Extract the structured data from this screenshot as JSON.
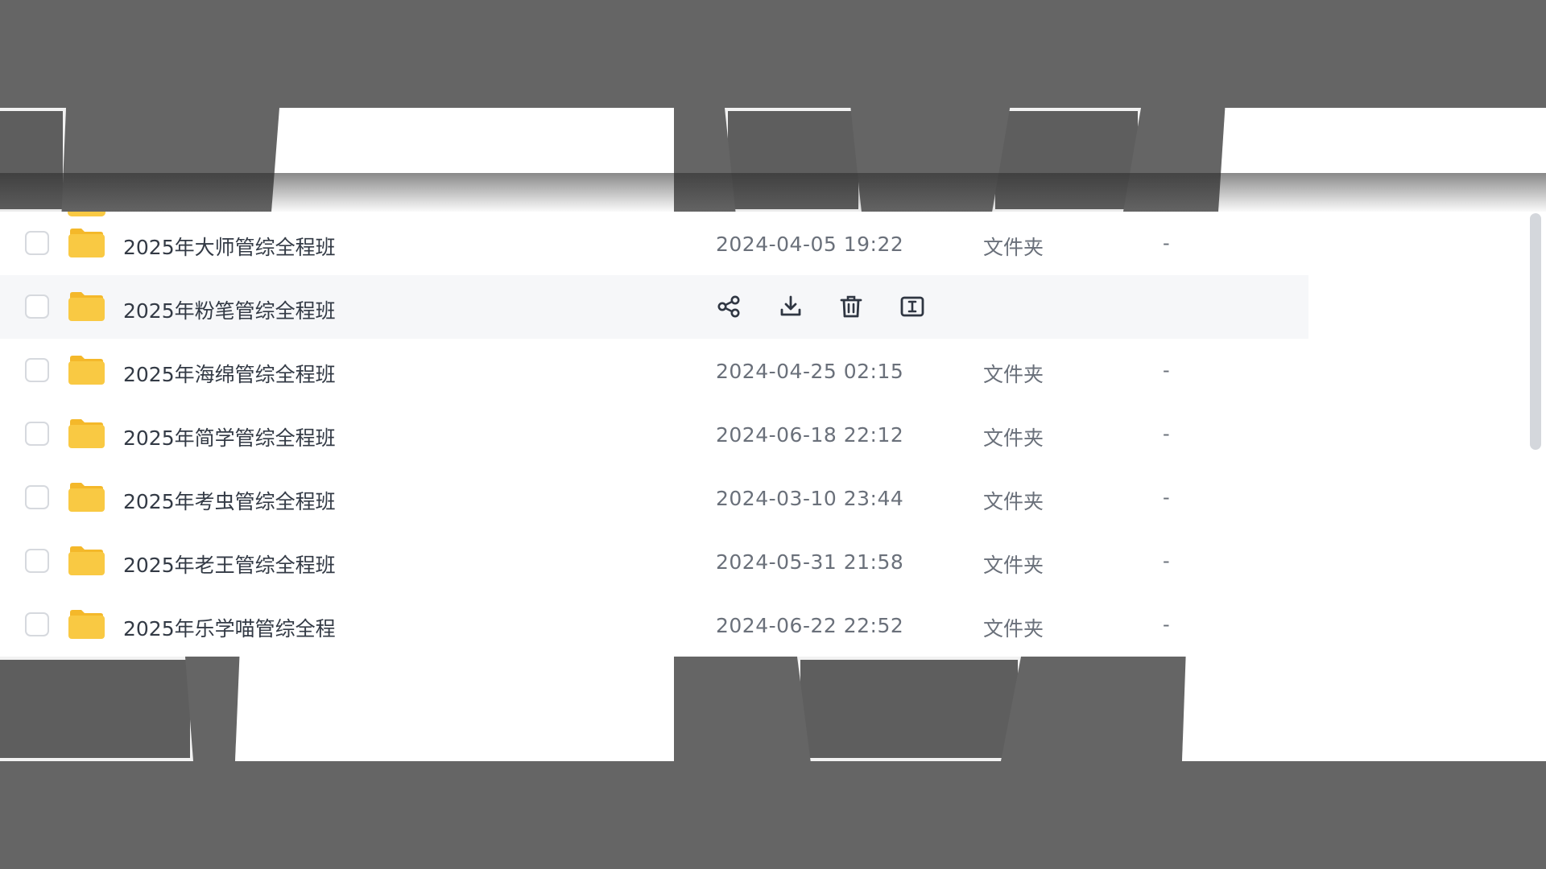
{
  "colors": {
    "folder": "#f9c943",
    "folder_tab": "#f4b82a",
    "text_primary": "#333a45",
    "text_secondary": "#6a707a",
    "row_hover": "#f6f7f9",
    "background_overlay": "#656565"
  },
  "icons": {
    "folder": "folder-icon",
    "share": "share-icon",
    "download": "download-icon",
    "delete": "trash-icon",
    "rename": "rename-icon"
  },
  "files": [
    {
      "name": "2025年大师管综全程班",
      "modified": "2024-04-05 19:22",
      "type": "文件夹",
      "size": "-",
      "hovered": false
    },
    {
      "name": "2025年粉笔管综全程班",
      "modified": "",
      "type": "",
      "size": "",
      "hovered": true
    },
    {
      "name": "2025年海绵管综全程班",
      "modified": "2024-04-25 02:15",
      "type": "文件夹",
      "size": "-",
      "hovered": false
    },
    {
      "name": "2025年简学管综全程班",
      "modified": "2024-06-18 22:12",
      "type": "文件夹",
      "size": "-",
      "hovered": false
    },
    {
      "name": "2025年考虫管综全程班",
      "modified": "2024-03-10 23:44",
      "type": "文件夹",
      "size": "-",
      "hovered": false
    },
    {
      "name": "2025年老王管综全程班",
      "modified": "2024-05-31 21:58",
      "type": "文件夹",
      "size": "-",
      "hovered": false
    },
    {
      "name": "2025年乐学喵管综全程",
      "modified": "2024-06-22 22:52",
      "type": "文件夹",
      "size": "-",
      "hovered": false
    }
  ]
}
